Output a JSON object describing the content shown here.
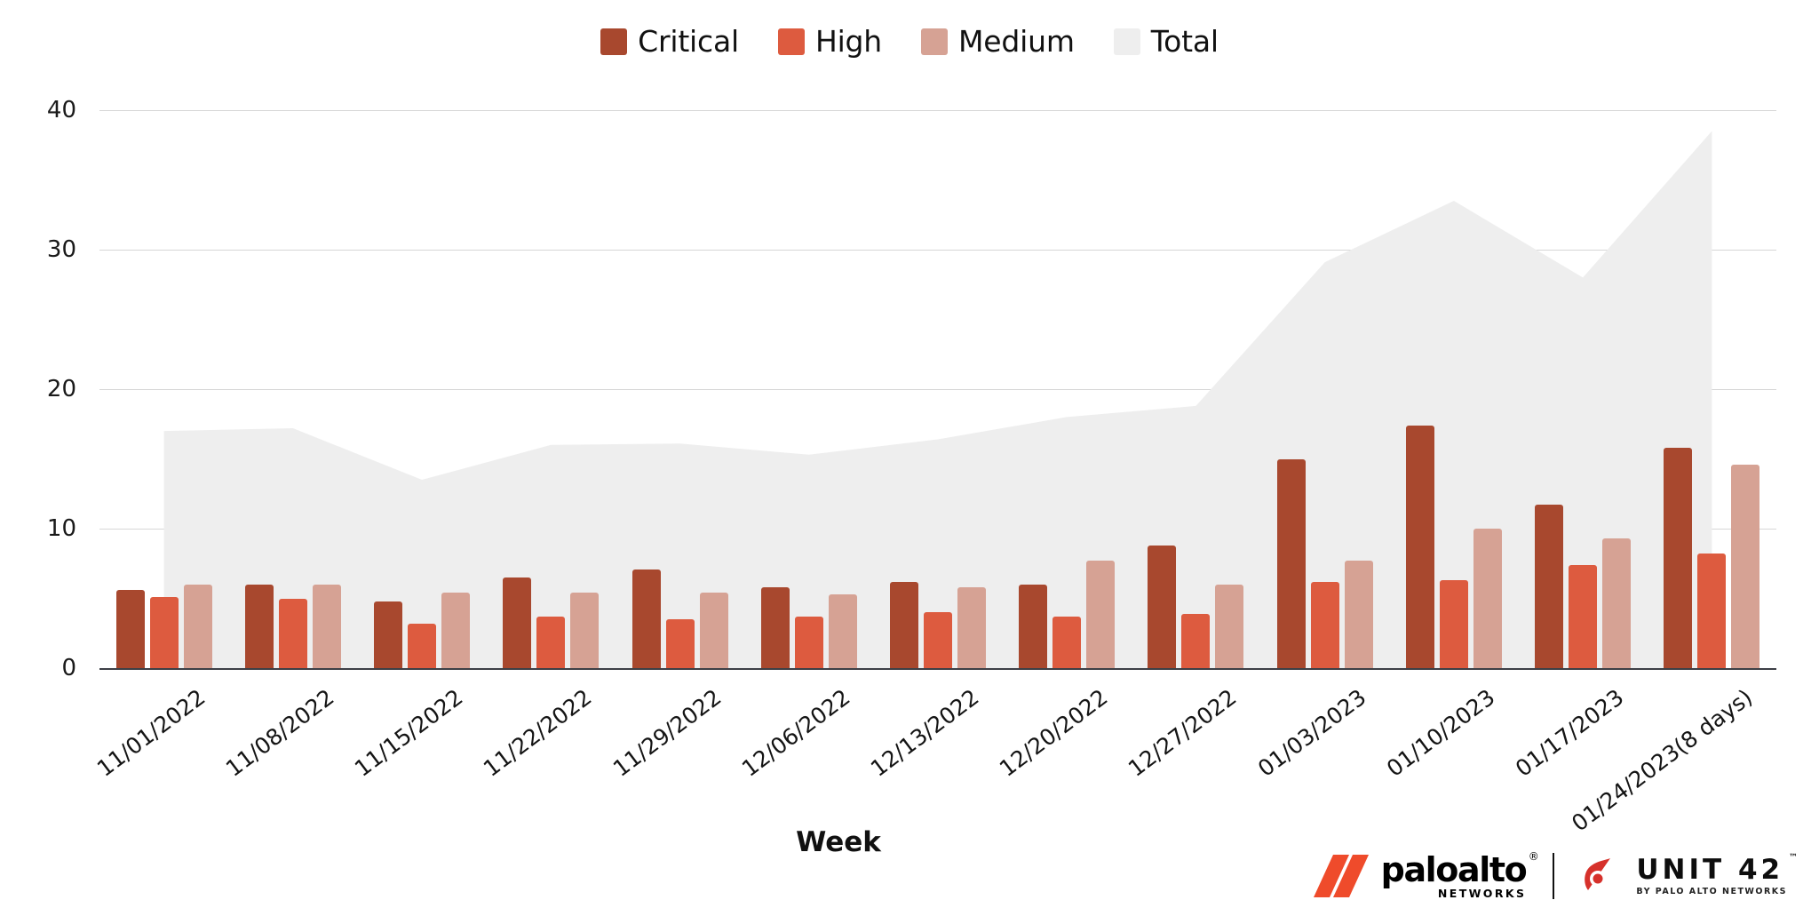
{
  "legend": {
    "items": [
      {
        "label": "Critical",
        "color": "#a8482e"
      },
      {
        "label": "High",
        "color": "#dd5b3f"
      },
      {
        "label": "Medium",
        "color": "#d6a294"
      },
      {
        "label": "Total",
        "color": "#eeeeee"
      }
    ]
  },
  "axis": {
    "x_title": "Week",
    "y_ticks": [
      "0",
      "10",
      "20",
      "30",
      "40"
    ]
  },
  "footer": {
    "paloalto_name": "paloalto",
    "paloalto_reg": "®",
    "paloalto_sub": "NETWORKS",
    "unit42_name": "UNIT 42",
    "unit42_tm": "™",
    "unit42_sub": "BY PALO ALTO NETWORKS"
  },
  "chart_data": {
    "type": "bar",
    "title": "",
    "xlabel": "Week",
    "ylabel": "",
    "ylim": [
      0,
      40
    ],
    "y_ticks": [
      0,
      10,
      20,
      30,
      40
    ],
    "grid": true,
    "legend_position": "top-center",
    "categories": [
      "11/01/2022",
      "11/08/2022",
      "11/15/2022",
      "11/22/2022",
      "11/29/2022",
      "12/06/2022",
      "12/13/2022",
      "12/20/2022",
      "12/27/2022",
      "01/03/2023",
      "01/10/2023",
      "01/17/2023",
      "01/24/2023(8 days)"
    ],
    "series": [
      {
        "name": "Critical",
        "type": "bar",
        "color": "#a8482e",
        "values": [
          5.6,
          6.0,
          4.8,
          6.5,
          7.1,
          5.8,
          6.2,
          6.0,
          8.8,
          15.0,
          17.4,
          11.7,
          15.8
        ]
      },
      {
        "name": "High",
        "type": "bar",
        "color": "#dd5b3f",
        "values": [
          5.1,
          5.0,
          3.2,
          3.7,
          3.5,
          3.7,
          4.0,
          3.7,
          3.9,
          6.2,
          6.3,
          7.4,
          8.2
        ]
      },
      {
        "name": "Medium",
        "type": "bar",
        "color": "#d6a294",
        "values": [
          6.0,
          6.0,
          5.4,
          5.4,
          5.4,
          5.3,
          5.8,
          7.7,
          6.0,
          7.7,
          10.0,
          9.3,
          14.6
        ]
      },
      {
        "name": "Total",
        "type": "area",
        "color": "#eeeeee",
        "values": [
          17.0,
          17.2,
          13.5,
          16.0,
          16.1,
          15.3,
          16.4,
          18.0,
          18.8,
          29.1,
          33.5,
          28.0,
          38.5
        ]
      }
    ]
  }
}
